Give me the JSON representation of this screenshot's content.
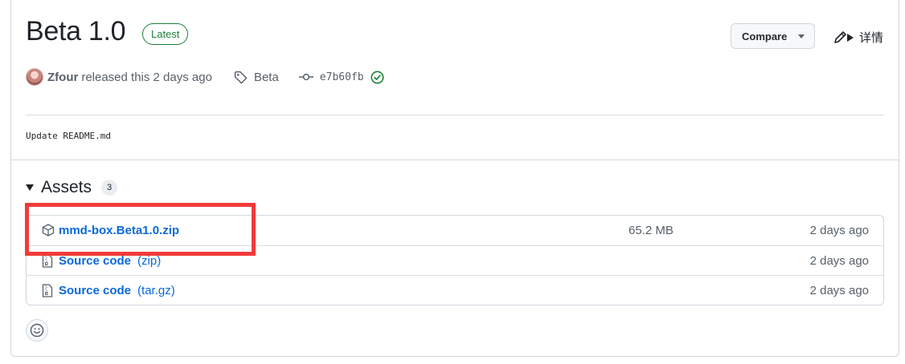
{
  "release": {
    "title": "Beta 1.0",
    "badge": "Latest",
    "compare_label": "Compare",
    "edit_label": "详情",
    "author": "Zfour",
    "released_text": "released this 2 days ago",
    "tag": "Beta",
    "commit": "e7b60fb",
    "body": "Update README.md"
  },
  "assets": {
    "title": "Assets",
    "count": "3",
    "items": [
      {
        "name": "mmd-box.Beta1.0.zip",
        "suffix": "",
        "size": "65.2 MB",
        "date": "2 days ago",
        "icon": "package-icon"
      },
      {
        "name": "Source code",
        "suffix": "(zip)",
        "size": "",
        "date": "2 days ago",
        "icon": "file-zip-icon"
      },
      {
        "name": "Source code",
        "suffix": "(tar.gz)",
        "size": "",
        "date": "2 days ago",
        "icon": "file-zip-icon"
      }
    ]
  },
  "colors": {
    "accent_link": "#0969da",
    "latest_green": "#1a7f37",
    "highlight_red": "#f23a3a"
  }
}
